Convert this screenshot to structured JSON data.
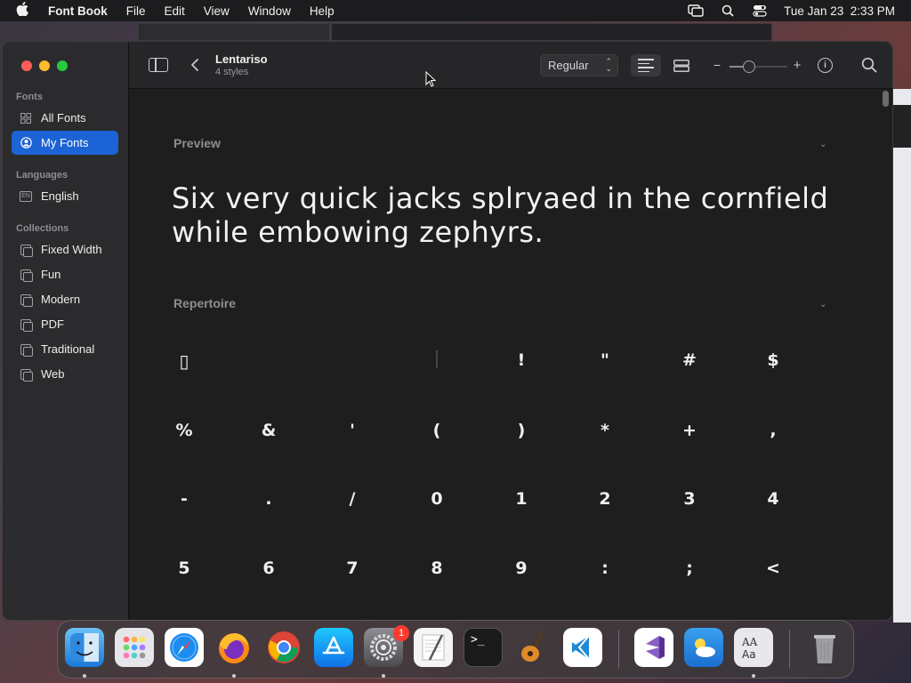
{
  "menubar": {
    "apple_icon": "apple-logo",
    "app_name": "Font Book",
    "menus": [
      "File",
      "Edit",
      "View",
      "Window",
      "Help"
    ],
    "datetime": "Tue Jan 23  2:33 PM"
  },
  "sidebar": {
    "sections": {
      "fonts": "Fonts",
      "languages": "Languages",
      "collections": "Collections"
    },
    "font_items": [
      {
        "label": "All Fonts",
        "icon": "grid-icon"
      },
      {
        "label": "My Fonts",
        "icon": "person-circle-icon",
        "selected": true
      }
    ],
    "language_items": [
      {
        "label": "English",
        "icon": "en-badge-icon",
        "badge": "EN"
      }
    ],
    "collection_items": [
      {
        "label": "Fixed Width"
      },
      {
        "label": "Fun"
      },
      {
        "label": "Modern"
      },
      {
        "label": "PDF"
      },
      {
        "label": "Traditional"
      },
      {
        "label": "Web"
      }
    ]
  },
  "toolbar": {
    "font_name": "Lentariso",
    "styles_count": "4 styles",
    "style_select": "Regular"
  },
  "content": {
    "preview_heading": "Preview",
    "preview_text": "Six very quick jacks splryaed in the cornfield while embowing zephyrs.",
    "repertoire_heading": "Repertoire",
    "glyphs": [
      [
        "▯",
        "",
        "!",
        "\"",
        "#",
        "$"
      ],
      [
        "%",
        "&",
        "'",
        "(",
        ")",
        "*",
        "+",
        ","
      ],
      [
        "-",
        ".",
        "/",
        "0",
        "1",
        "2",
        "3",
        "4"
      ],
      [
        "5",
        "6",
        "7",
        "8",
        "9",
        ":",
        ";",
        "<"
      ]
    ]
  },
  "dock": {
    "apps": [
      "Finder",
      "Launchpad",
      "Safari",
      "Firefox",
      "Chrome",
      "App Store",
      "System Settings",
      "TextEdit",
      "Terminal",
      "GarageBand",
      "Visual Studio Code",
      "Visual Studio",
      "Weather",
      "Font Book",
      "Trash"
    ],
    "system_settings_badge": "1"
  },
  "colors": {
    "accent": "#1c63d5",
    "window_bg": "#1e1e1e",
    "sidebar_bg": "#2b2b2d"
  }
}
